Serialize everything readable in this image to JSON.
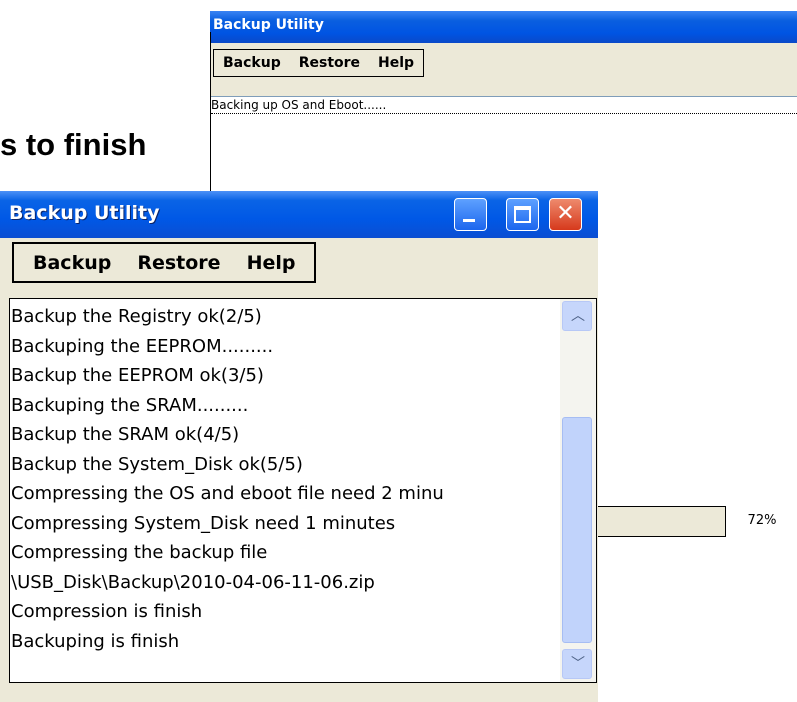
{
  "background_window": {
    "title": "Backup Utility",
    "menu": [
      "Backup",
      "Restore",
      "Help"
    ],
    "status_text": "Backing up OS and Eboot......"
  },
  "heading_fragment": "s to finish",
  "progress": {
    "value_percent": 72,
    "label": "72%"
  },
  "main_window": {
    "title": "Backup Utility",
    "menu": [
      "Backup",
      "Restore",
      "Help"
    ],
    "log_lines": [
      "Backup the Registry ok(2/5)",
      "Backuping the EEPROM.........",
      "Backup the EEPROM ok(3/5)",
      "Backuping the SRAM.........",
      "Backup the SRAM ok(4/5)",
      "Backup the System_Disk ok(5/5)",
      "Compressing the OS and eboot file need 2 minu",
      "Compressing System_Disk need 1 minutes",
      "Compressing the backup file",
      "\\USB_Disk\\Backup\\2010-04-06-11-06.zip",
      "Compression is finish",
      "Backuping is finish"
    ],
    "controls": {
      "minimize": "minimize-icon",
      "maximize": "maximize-icon",
      "close": "close-icon"
    }
  },
  "colors": {
    "titlebar": "#0054e3",
    "close": "#d6391c",
    "face": "#ece9d8",
    "scroll_thumb": "#c1d3fb"
  }
}
